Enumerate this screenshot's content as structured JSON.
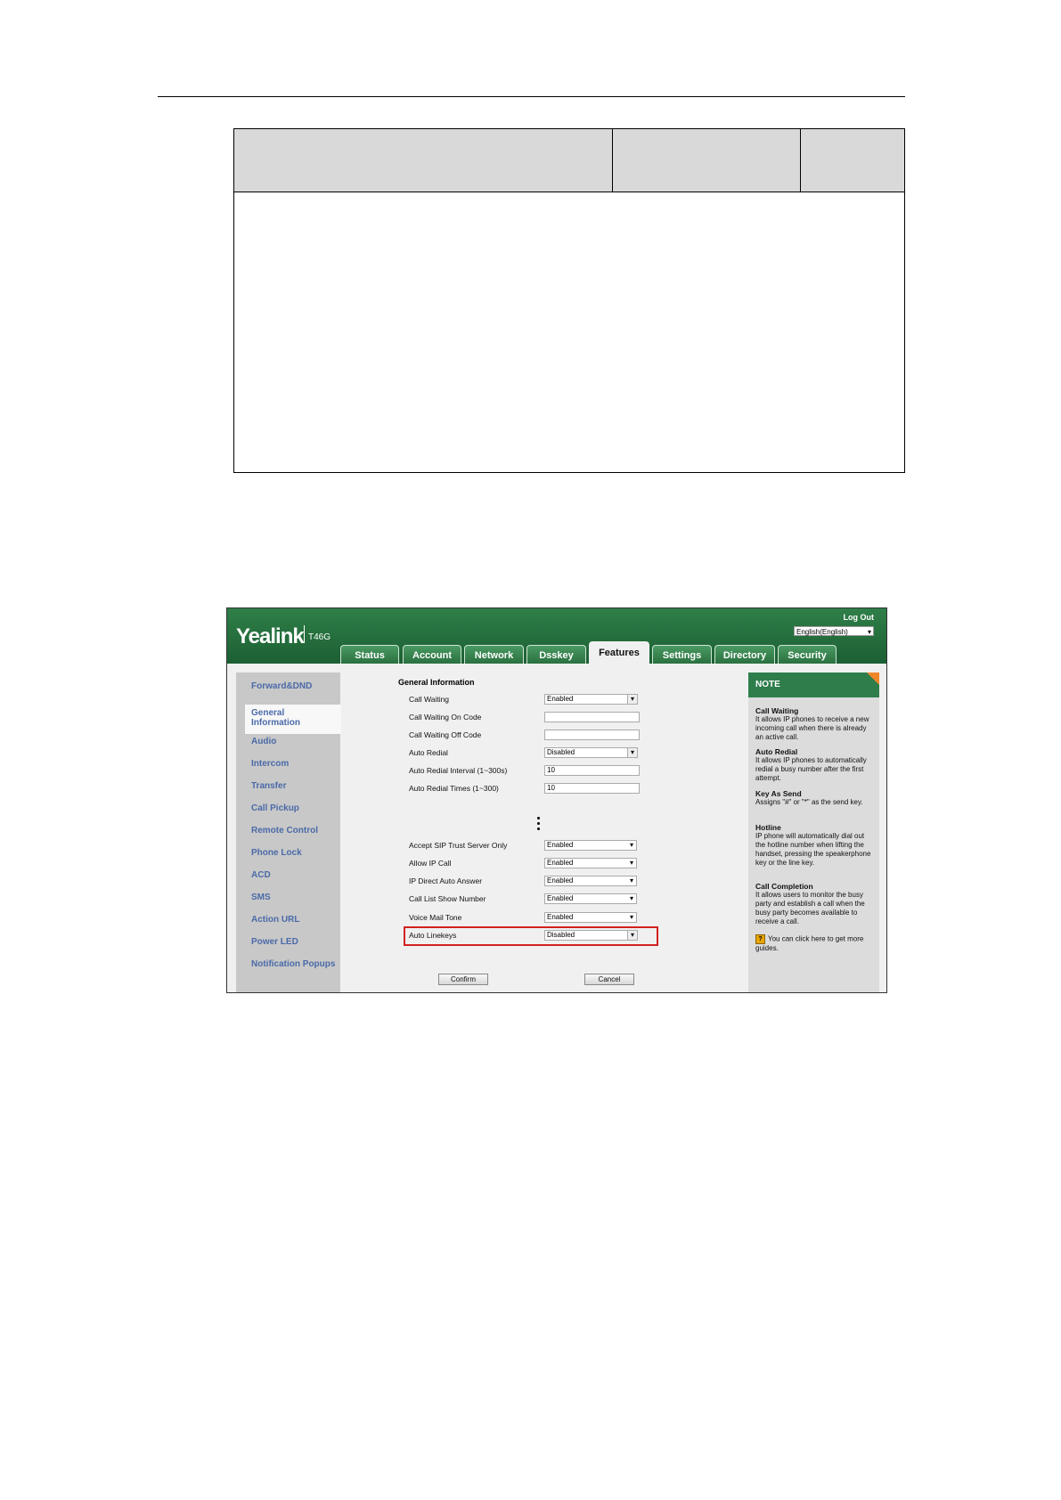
{
  "screenshot": {
    "brand": "Yealink",
    "model": "T46G",
    "logout_label": "Log Out",
    "language": "English(English)",
    "tabs": [
      "Status",
      "Account",
      "Network",
      "Dsskey",
      "Features",
      "Settings",
      "Directory",
      "Security"
    ],
    "active_tab": "Features",
    "sidebar": [
      "Forward&DND",
      "General Information",
      "Audio",
      "Intercom",
      "Transfer",
      "Call Pickup",
      "Remote Control",
      "Phone Lock",
      "ACD",
      "SMS",
      "Action URL",
      "Power LED",
      "Notification Popups"
    ],
    "sidebar_active": "General Information",
    "section_title": "General Information",
    "rows_top": [
      {
        "label": "Call Waiting",
        "value": "Enabled"
      },
      {
        "label": "Call Waiting On Code",
        "value": ""
      },
      {
        "label": "Call Waiting Off Code",
        "value": ""
      },
      {
        "label": "Auto Redial",
        "value": "Disabled"
      },
      {
        "label": "Auto Redial Interval (1~300s)",
        "value": "10"
      },
      {
        "label": "Auto Redial Times (1~300)",
        "value": "10"
      }
    ],
    "rows_bottom": [
      {
        "label": "Accept SIP Trust Server Only",
        "value": "Enabled"
      },
      {
        "label": "Allow IP Call",
        "value": "Enabled"
      },
      {
        "label": "IP Direct Auto Answer",
        "value": "Enabled"
      },
      {
        "label": "Call List Show Number",
        "value": "Enabled"
      },
      {
        "label": "Voice Mail Tone",
        "value": "Enabled"
      },
      {
        "label": "Auto Linekeys",
        "value": "Disabled"
      }
    ],
    "confirm_label": "Confirm",
    "cancel_label": "Cancel",
    "note": {
      "title": "NOTE",
      "items": [
        {
          "heading": "Call Waiting",
          "text": "It allows IP phones to receive a new incoming call when there is already an active call."
        },
        {
          "heading": "Auto Redial",
          "text": "It allows IP phones to automatically redial a busy number after the first attempt."
        },
        {
          "heading": "Key As Send",
          "text": "Assigns \"#\" or \"*\" as the send key."
        },
        {
          "heading": "Hotline",
          "text": "IP phone will automatically dial out the hotline number when lifting the handset, pressing the speakerphone key or the line key."
        },
        {
          "heading": "Call Completion",
          "text": "It allows users to monitor the busy party and establish a call when the busy party becomes available to receive a call."
        }
      ],
      "help_text": "You can click here to get more guides.",
      "help_icon": "question-icon"
    },
    "colors": {
      "header_green": "#1c5f33",
      "highlight_red": "#d42020",
      "sidebar_link": "#4a6aa8"
    }
  }
}
